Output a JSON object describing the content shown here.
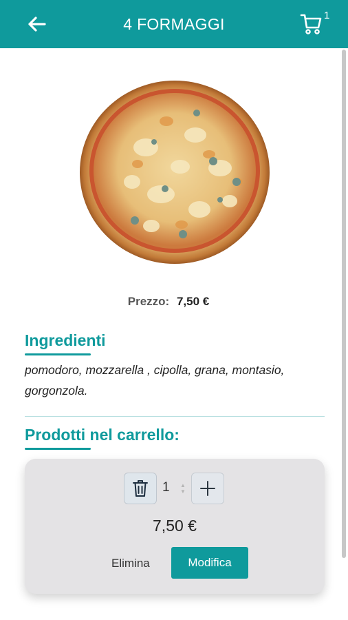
{
  "header": {
    "title": "4 FORMAGGI",
    "back_icon": "arrow-left-icon",
    "cart_icon": "cart-icon",
    "cart_count": "1",
    "color": "#0f9a9c"
  },
  "product": {
    "image": "pizza-image",
    "price_label": "Prezzo:",
    "price_value": "7,50 €"
  },
  "ingredients": {
    "heading": "Ingredienti",
    "text": "pomodoro, mozzarella , cipolla, grana, montasio, gorgonzola."
  },
  "cart_section": {
    "heading": "Prodotti nel carrello:",
    "item": {
      "quantity": "1",
      "trash_icon": "trash-icon",
      "plus_icon": "plus-icon",
      "line_total": "7,50 €",
      "delete_label": "Elimina",
      "edit_label": "Modifica"
    }
  }
}
